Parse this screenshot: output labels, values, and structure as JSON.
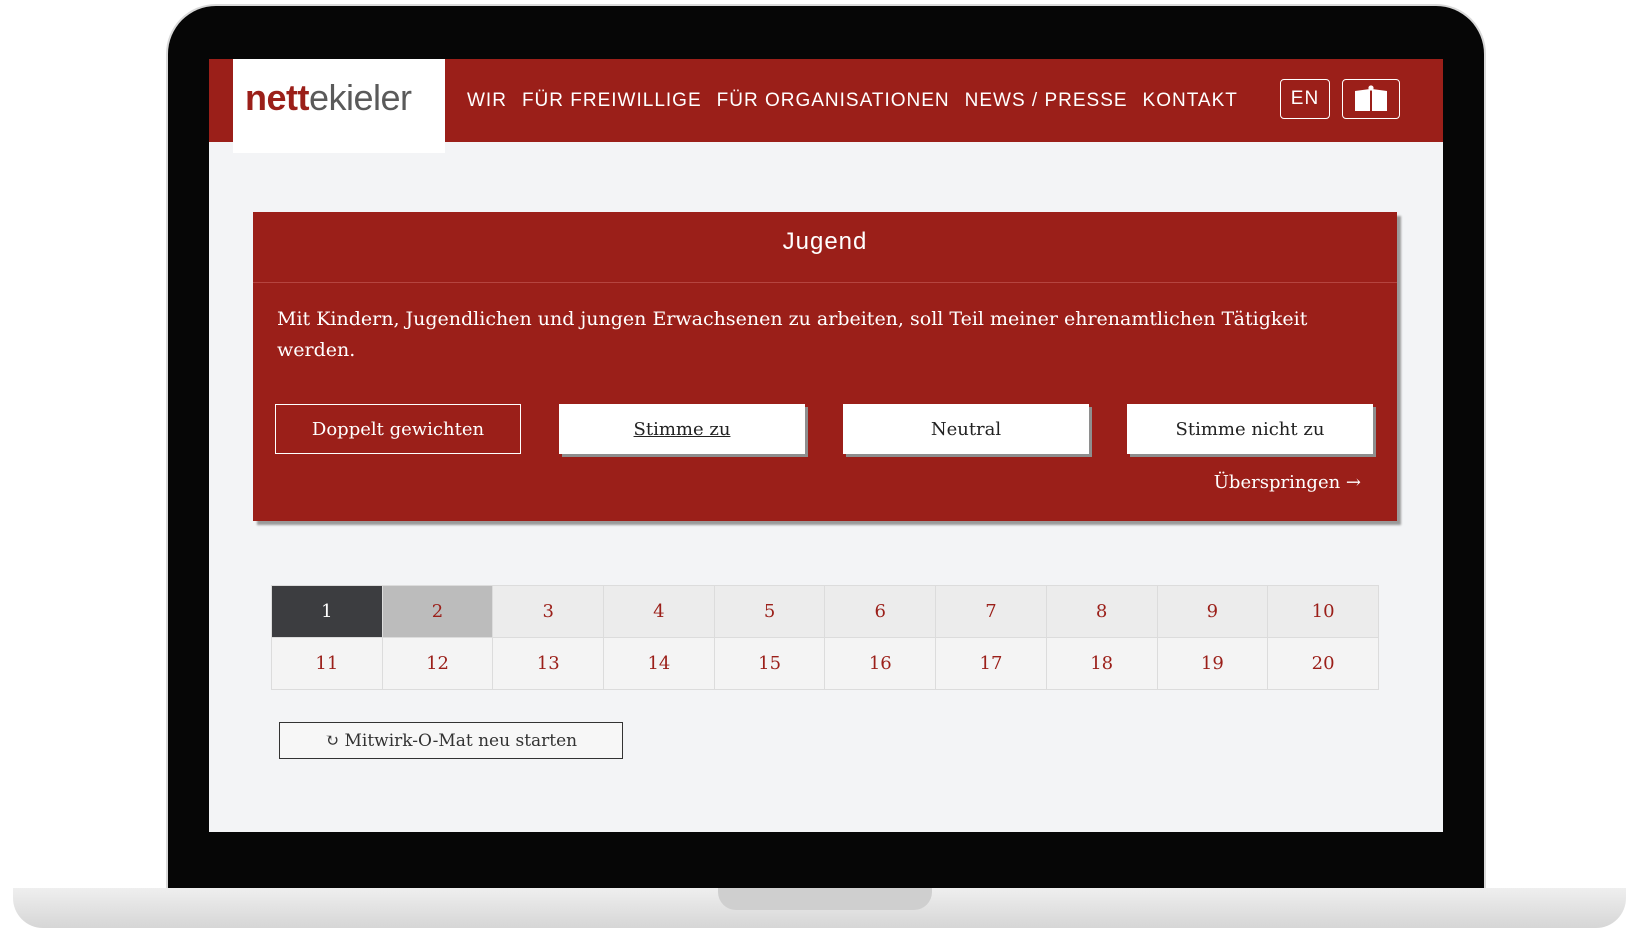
{
  "header": {
    "logo_a": "nett",
    "logo_b": "ekieler",
    "nav": [
      "WIR",
      "FÜR FREIWILLIGE",
      "FÜR ORGANISATIONEN",
      "NEWS / PRESSE",
      "KONTAKT"
    ],
    "lang": "EN"
  },
  "card": {
    "title": "Jugend",
    "question": "Mit Kindern, Jugendlichen und jungen Erwachsenen zu arbeiten, soll Teil meiner ehrenamtlichen Tätigkeit werden.",
    "btn_double": "Doppelt gewichten",
    "btn_agree": "Stimme zu",
    "btn_neutral": "Neutral",
    "btn_disagree": "Stimme nicht zu",
    "skip": "Überspringen →"
  },
  "grid": {
    "row1": [
      "1",
      "2",
      "3",
      "4",
      "5",
      "6",
      "7",
      "8",
      "9",
      "10"
    ],
    "row2": [
      "11",
      "12",
      "13",
      "14",
      "15",
      "16",
      "17",
      "18",
      "19",
      "20"
    ],
    "active": "1",
    "visited": "2"
  },
  "restart": "↻ Mitwirk-O-Mat neu starten",
  "colors": {
    "brand_red": "#9b1f19",
    "active_cell": "#3c3d40",
    "visited_cell": "#bcbcbc"
  }
}
